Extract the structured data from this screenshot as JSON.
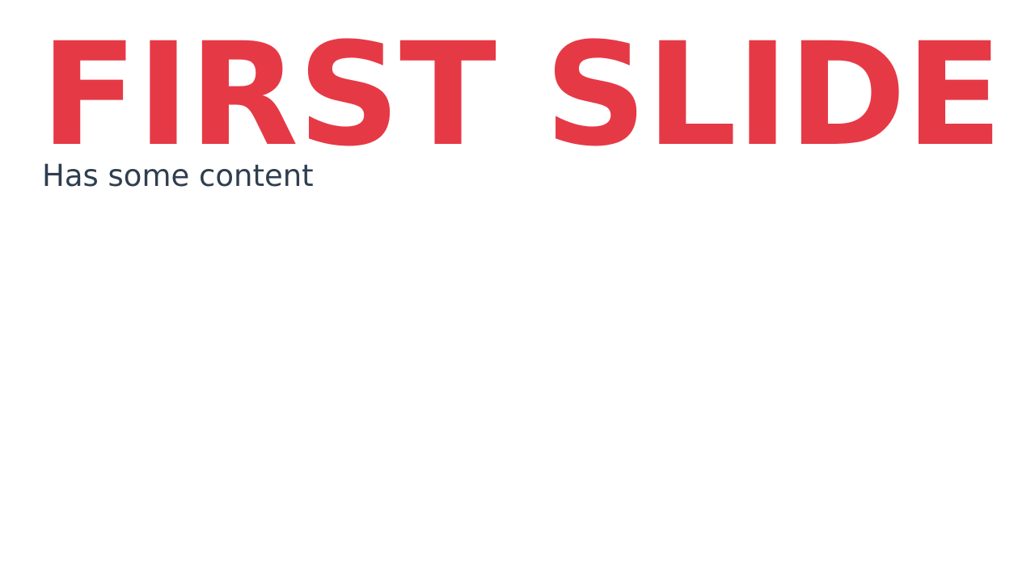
{
  "slide": {
    "title": "FIRST SLIDE",
    "subtitle": "Has some content"
  },
  "colors": {
    "title": "#e63946",
    "subtitle": "#2f3e4f",
    "background": "#ffffff"
  }
}
